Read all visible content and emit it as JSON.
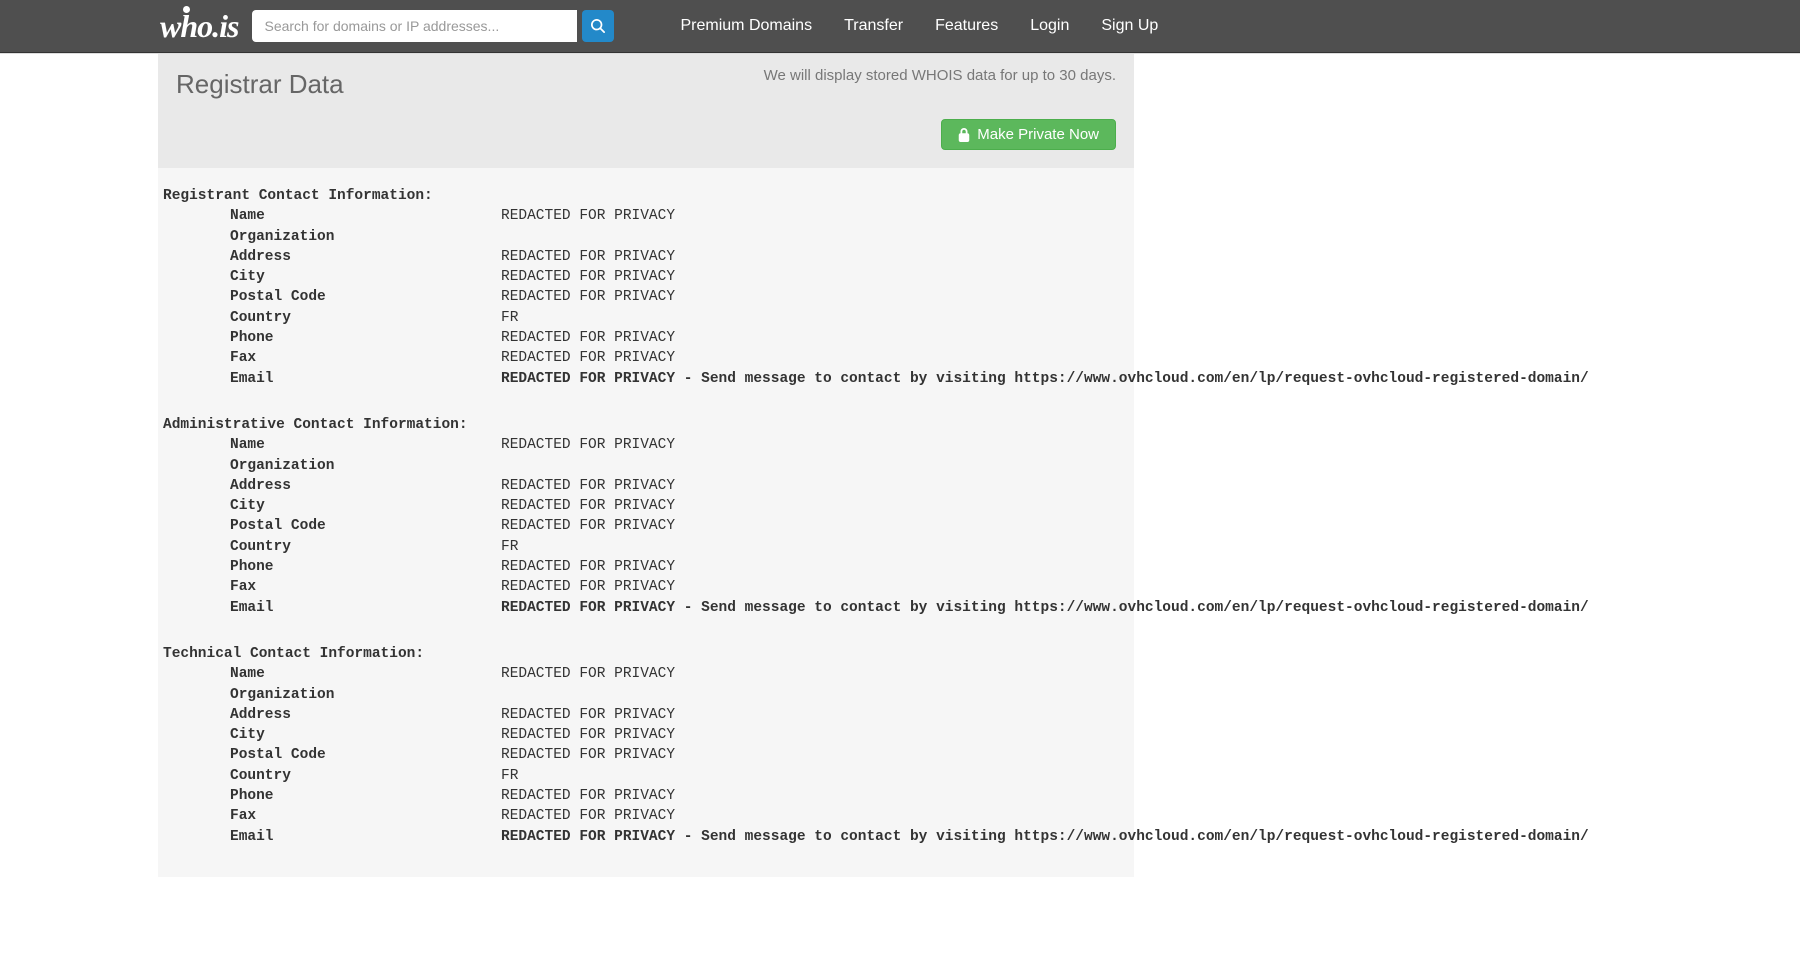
{
  "nav": {
    "logo_text": "who.is",
    "search_placeholder": "Search for domains or IP addresses...",
    "links": {
      "premium": "Premium Domains",
      "transfer": "Transfer",
      "features": "Features",
      "login": "Login",
      "signup": "Sign Up"
    }
  },
  "header": {
    "title": "Registrar Data",
    "info": "We will display stored WHOIS data for up to 30 days.",
    "private_btn": "Make Private Now"
  },
  "sections": {
    "registrant": {
      "title": "Registrant Contact Information:",
      "fields": {
        "name_label": "Name",
        "name_value": "REDACTED FOR PRIVACY",
        "organization_label": "Organization",
        "organization_value": "",
        "address_label": "Address",
        "address_value": "REDACTED FOR PRIVACY",
        "city_label": "City",
        "city_value": "REDACTED FOR PRIVACY",
        "postal_label": "Postal Code",
        "postal_value": "REDACTED FOR PRIVACY",
        "country_label": "Country",
        "country_value": "FR",
        "phone_label": "Phone",
        "phone_value": "REDACTED FOR PRIVACY",
        "fax_label": "Fax",
        "fax_value": "REDACTED FOR PRIVACY",
        "email_label": "Email",
        "email_value": "REDACTED FOR PRIVACY - Send message to contact by visiting https://www.ovhcloud.com/en/lp/request-ovhcloud-registered-domain/"
      }
    },
    "admin": {
      "title": "Administrative Contact Information:",
      "fields": {
        "name_label": "Name",
        "name_value": "REDACTED FOR PRIVACY",
        "organization_label": "Organization",
        "organization_value": "",
        "address_label": "Address",
        "address_value": "REDACTED FOR PRIVACY",
        "city_label": "City",
        "city_value": "REDACTED FOR PRIVACY",
        "postal_label": "Postal Code",
        "postal_value": "REDACTED FOR PRIVACY",
        "country_label": "Country",
        "country_value": "FR",
        "phone_label": "Phone",
        "phone_value": "REDACTED FOR PRIVACY",
        "fax_label": "Fax",
        "fax_value": "REDACTED FOR PRIVACY",
        "email_label": "Email",
        "email_value": "REDACTED FOR PRIVACY - Send message to contact by visiting https://www.ovhcloud.com/en/lp/request-ovhcloud-registered-domain/"
      }
    },
    "technical": {
      "title": "Technical Contact Information:",
      "fields": {
        "name_label": "Name",
        "name_value": "REDACTED FOR PRIVACY",
        "organization_label": "Organization",
        "organization_value": "",
        "address_label": "Address",
        "address_value": "REDACTED FOR PRIVACY",
        "city_label": "City",
        "city_value": "REDACTED FOR PRIVACY",
        "postal_label": "Postal Code",
        "postal_value": "REDACTED FOR PRIVACY",
        "country_label": "Country",
        "country_value": "FR",
        "phone_label": "Phone",
        "phone_value": "REDACTED FOR PRIVACY",
        "fax_label": "Fax",
        "fax_value": "REDACTED FOR PRIVACY",
        "email_label": "Email",
        "email_value": "REDACTED FOR PRIVACY - Send message to contact by visiting https://www.ovhcloud.com/en/lp/request-ovhcloud-registered-domain/"
      }
    }
  }
}
